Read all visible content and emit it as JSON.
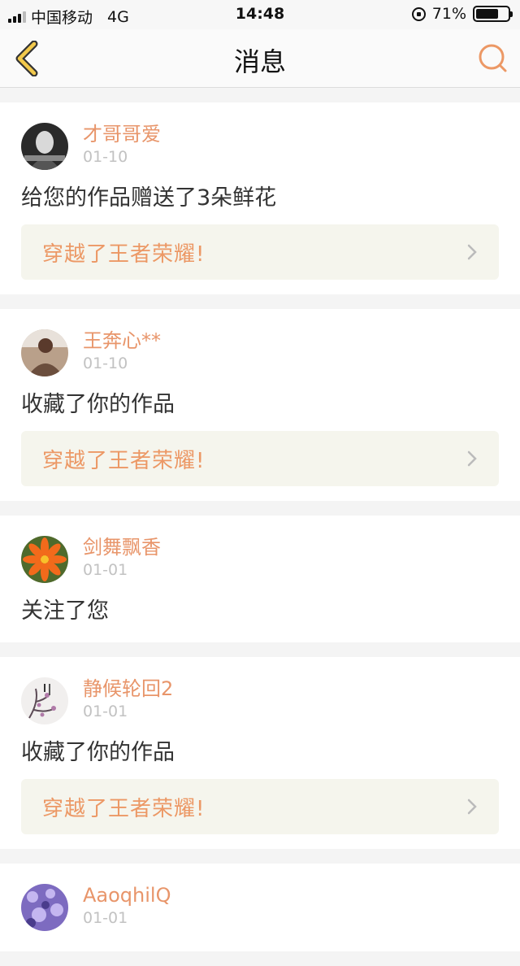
{
  "status_bar": {
    "carrier": "中国移动",
    "network": "4G",
    "time": "14:48",
    "battery": "71%",
    "battery_level": 0.71
  },
  "nav": {
    "title": "消息",
    "back_icon": "chevron-left-icon",
    "right_icon": "chat-bubble-icon",
    "accent": "#e8b44a"
  },
  "messages": [
    {
      "username": "才哥哥爱",
      "date": "01-10",
      "action": "给您的作品赠送了3朵鲜花",
      "work_title": "穿越了王者荣耀!",
      "avatar": "dark-portrait"
    },
    {
      "username": "王奔心**",
      "date": "01-10",
      "action": "收藏了你的作品",
      "work_title": "穿越了王者荣耀!",
      "avatar": "person-photo"
    },
    {
      "username": "剑舞飘香",
      "date": "01-01",
      "action": "关注了您",
      "avatar": "orange-flower"
    },
    {
      "username": "静候轮回2",
      "date": "01-01",
      "action": "收藏了你的作品",
      "work_title": "穿越了王者荣耀!",
      "avatar": "ink-painting"
    },
    {
      "username": "AaoqhilQ",
      "date": "01-01",
      "avatar": "purple-flowers"
    }
  ],
  "colors": {
    "username": "#e8956a",
    "work_title": "#ec9865",
    "work_bg": "#f5f5ed",
    "page_bg": "#f4f4f4"
  }
}
